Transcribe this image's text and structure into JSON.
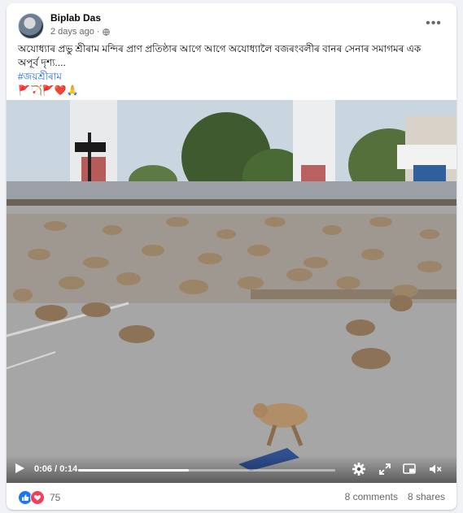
{
  "post": {
    "author": "Biplab Das",
    "timestamp": "2 days ago",
    "text_line1": "অযোধ্যাৰ প্ৰভু শ্ৰীৰাম মন্দিৰ প্ৰাণ প্ৰতিষ্ঠাৰ আগে আগে অযোধ্যালৈ বজৰংবলীৰ বানৰ সেনাৰ সমাগমৰ এক",
    "text_line2": "অপূৰ্ব দৃশ্য....",
    "hashtag": "#জয়শ্ৰীৰাম",
    "emojis": "🚩🏹🚩❤️🙏"
  },
  "video": {
    "current_time": "0:06",
    "separator": "/",
    "duration": "0:14",
    "progress_fraction": 0.43
  },
  "footer": {
    "reaction_count": "75",
    "comments": "8 comments",
    "shares": "8 shares"
  },
  "colors": {
    "link": "#216fdb",
    "like": "#1877f2",
    "love": "#f33e58"
  },
  "icons": [
    "globe-icon",
    "more-options-icon",
    "play-icon",
    "settings-icon",
    "fullscreen-icon",
    "pip-icon",
    "volume-muted-icon",
    "like-reaction-icon",
    "love-reaction-icon"
  ]
}
